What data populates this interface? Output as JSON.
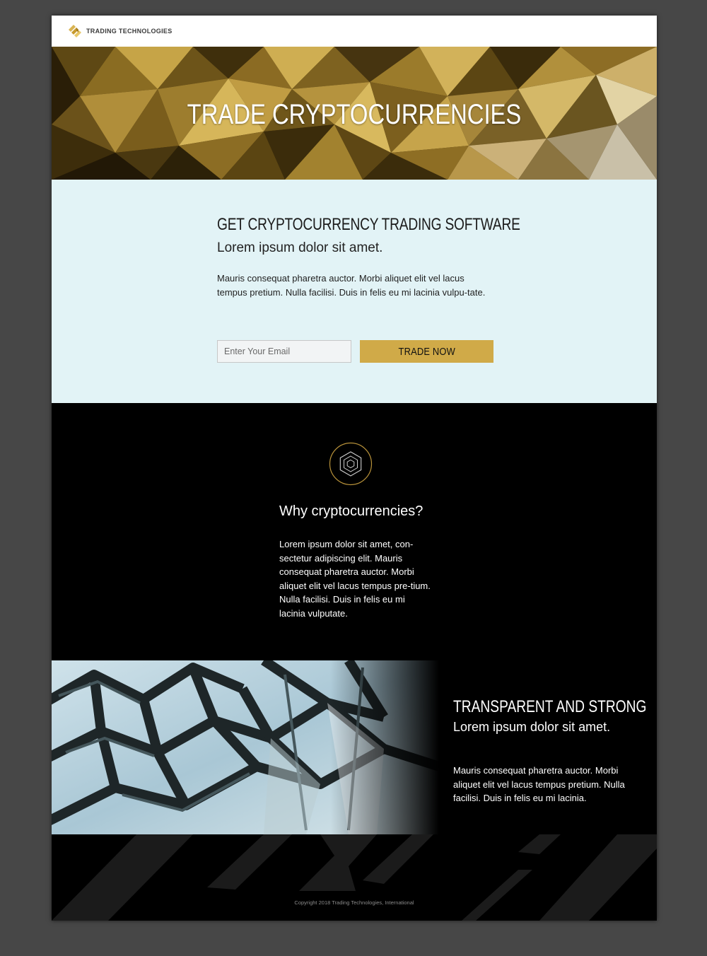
{
  "header": {
    "logo_text": "TRADING TECHNOLOGIES",
    "logo_icon": "tt-gold-stripes-icon"
  },
  "hero": {
    "title": "TRADE CRYPTOCURRENCIES"
  },
  "signup": {
    "heading": "GET CRYPTOCURRENCY TRADING SOFTWARE",
    "subheading": "Lorem ipsum dolor sit amet.",
    "body": "Mauris consequat pharetra auctor. Morbi aliquet elit vel lacus tempus pretium. Nulla facilisi. Duis in felis eu mi lacinia vulpu-tate.",
    "email_placeholder": "Enter Your Email",
    "email_value": "",
    "button_label": "TRADE NOW"
  },
  "why": {
    "icon": "hexagon-icon",
    "heading": "Why cryptocurrencies?",
    "body": "Lorem ipsum dolor sit amet, con-sectetur adipiscing elit. Mauris consequat pharetra auctor. Morbi aliquet elit vel lacus tempus pre-tium. Nulla facilisi. Duis in felis eu mi lacinia vulputate."
  },
  "feature": {
    "heading": "TRANSPARENT AND STRONG",
    "subheading": "Lorem ipsum dolor sit amet.",
    "body": "Mauris consequat pharetra auctor. Morbi aliquet elit vel lacus tempus pretium. Nulla facilisi. Duis in felis eu mi lacinia."
  },
  "footer": {
    "copyright": "Copyright 2018 Trading Technologies, International"
  },
  "colors": {
    "page_bg": "#474747",
    "accent_gold": "#d0aa48",
    "signup_bg": "#e2f3f6",
    "dark_bg": "#000000"
  }
}
